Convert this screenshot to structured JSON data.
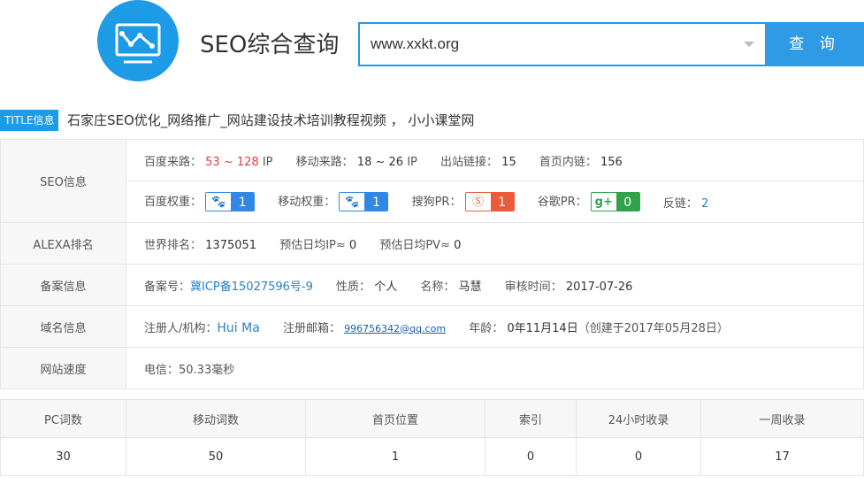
{
  "header": {
    "app_title": "SEO综合查询",
    "logo_icon": "chart-monitor-icon",
    "search_value": "www.xxkt.org",
    "search_button_label": "查 询",
    "accent_color": "#1e9be6"
  },
  "title_row": {
    "badge": "TITLE信息",
    "text": "石家庄SEO优化_网络推广_网站建设技术培训教程视频 ， 小小课堂网"
  },
  "seo_info": {
    "label": "SEO信息",
    "baidu_source_label": "百度来路：",
    "baidu_source_value": "53 ~ 128",
    "baidu_source_unit": "IP",
    "mobile_source_label": "移动来路：",
    "mobile_source_value": "18 ~ 26",
    "mobile_source_unit": "IP",
    "outlinks_label": "出站链接：",
    "outlinks_value": "15",
    "inlinks_label": "首页内链：",
    "inlinks_value": "156",
    "baidu_weight_label": "百度权重：",
    "baidu_weight_value": "1",
    "mobile_weight_label": "移动权重：",
    "mobile_weight_value": "1",
    "sogou_pr_label": "搜狗PR：",
    "sogou_pr_value": "1",
    "google_pr_label": "谷歌PR：",
    "google_pr_value": "0",
    "backlinks_label": "反链：",
    "backlinks_value": "2"
  },
  "alexa": {
    "label": "ALEXA排名",
    "world_rank_label": "世界排名：",
    "world_rank_value": "1375051",
    "daily_ip_label": "预估日均IP≈",
    "daily_ip_value": "0",
    "daily_pv_label": "预估日均PV≈",
    "daily_pv_value": "0"
  },
  "icp": {
    "label": "备案信息",
    "number_label": "备案号：",
    "number_value": "冀ICP备15027596号-9",
    "nature_label": "性质：",
    "nature_value": "个人",
    "name_label": "名称：",
    "name_value": "马慧",
    "review_label": "审核时间：",
    "review_value": "2017-07-26"
  },
  "domain": {
    "label": "域名信息",
    "registrant_label": "注册人/机构：",
    "registrant_value": "Hui Ma",
    "email_label": "注册邮箱：",
    "email_value": "996756342@qq.com",
    "age_label": "年龄：",
    "age_value": "0年11月14日",
    "created_note": "（创建于2017年05月28日）"
  },
  "speed": {
    "label": "网站速度",
    "value": "电信：50.33毫秒"
  },
  "stats": {
    "headers": [
      "PC词数",
      "移动词数",
      "首页位置",
      "索引",
      "24小时收录",
      "一周收录"
    ],
    "values": [
      "30",
      "50",
      "1",
      "0",
      "0",
      "17"
    ]
  }
}
